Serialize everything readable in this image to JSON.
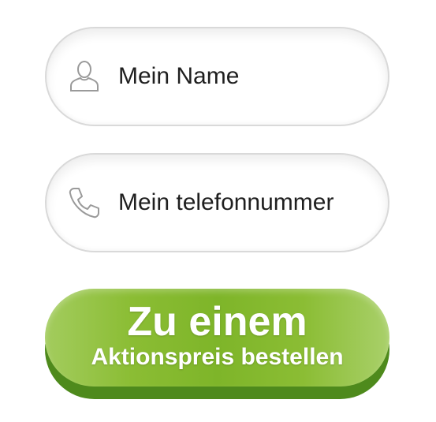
{
  "form": {
    "name_field": {
      "placeholder": "Mein Name",
      "icon": "user-icon"
    },
    "phone_field": {
      "placeholder": "Mein telefonnummer",
      "icon": "phone-icon"
    },
    "submit_button": {
      "line1": "Zu einem",
      "line2": "Aktionspreis bestellen",
      "color": "#7eb529"
    }
  }
}
